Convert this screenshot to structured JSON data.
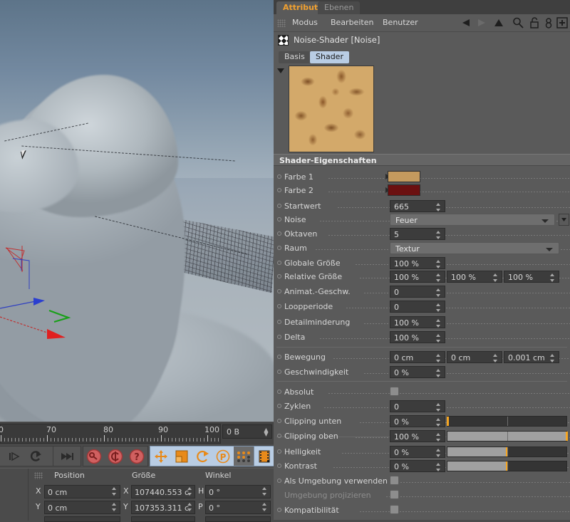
{
  "attribute_manager": {
    "tabs": [
      {
        "label": "Attribute",
        "active": true
      },
      {
        "label": "Ebenen",
        "active": false
      }
    ],
    "menu": [
      "Modus",
      "Bearbeiten",
      "Benutzer"
    ],
    "menu_icons": [
      "back-arrow-icon",
      "forward-arrow-icon",
      "up-arrow-icon",
      "search-icon",
      "unlock-icon",
      "link-icon",
      "plus-box-icon"
    ],
    "object_name": "Noise-Shader [Noise]",
    "subtabs": [
      {
        "label": "Basis",
        "active": false
      },
      {
        "label": "Shader",
        "active": true
      }
    ],
    "section_title": "Shader-Eigenschaften",
    "colors": {
      "accent_orange": "#f0a030",
      "tab_active_blue": "#b9cde4",
      "farbe1": "#c49a5e",
      "farbe2": "#6b1010",
      "slider_handle": "#f5a623"
    },
    "properties": [
      {
        "label": "Farbe 1",
        "type": "color",
        "value": "#c49a5e"
      },
      {
        "label": "Farbe 2",
        "type": "color",
        "value": "#6b1010"
      },
      {
        "label": "Startwert",
        "type": "number",
        "value": "665"
      },
      {
        "label": "Noise",
        "type": "combo",
        "value": "Feuer"
      },
      {
        "label": "Oktaven",
        "type": "number",
        "value": "5"
      },
      {
        "label": "Raum",
        "type": "combo",
        "value": "Textur"
      },
      {
        "label": "Globale Größe",
        "type": "number",
        "value": "100 %"
      },
      {
        "label": "Relative Größe",
        "type": "number3",
        "value": "100 %",
        "value2": "100 %",
        "value3": "100 %"
      },
      {
        "label": "Animat.-Geschw.",
        "type": "number",
        "value": "0"
      },
      {
        "label": "Loopperiode",
        "type": "number",
        "value": "0"
      },
      {
        "label": "Detailminderung",
        "type": "number",
        "value": "100 %"
      },
      {
        "label": "Delta",
        "type": "number",
        "value": "100 %"
      },
      {
        "label": "Bewegung",
        "type": "number3",
        "value": "0 cm",
        "value2": "0 cm",
        "value3": "0.001 cm"
      },
      {
        "label": "Geschwindigkeit",
        "type": "number",
        "value": "0 %"
      },
      {
        "label": "Absolut",
        "type": "checkbox",
        "checked": false
      },
      {
        "label": "Zyklen",
        "type": "number",
        "value": "0"
      },
      {
        "label": "Clipping unten",
        "type": "slider",
        "value": "0 %",
        "fill": 0
      },
      {
        "label": "Clipping oben",
        "type": "slider",
        "value": "100 %",
        "fill": 100
      },
      {
        "label": "Helligkeit",
        "type": "slider",
        "value": "0 %",
        "fill": 50
      },
      {
        "label": "Kontrast",
        "type": "slider",
        "value": "0 %",
        "fill": 50
      },
      {
        "label": "Als Umgebung verwenden",
        "type": "checkbox",
        "checked": false
      },
      {
        "label": "Umgebung projizieren",
        "type": "checkbox",
        "checked": false,
        "disabled": true
      },
      {
        "label": "Kompatibilität",
        "type": "checkbox",
        "checked": false
      }
    ]
  },
  "viewport": {
    "gizmo_axes": [
      "x-axis-red",
      "y-axis-green",
      "z-axis-blue"
    ],
    "cursor": "mouse-pointer"
  },
  "timeline": {
    "tick_labels": [
      "0",
      "70",
      "80",
      "90",
      "100"
    ],
    "frame_value": "0 B"
  },
  "toolbar": {
    "buttons": [
      "play-forward-icon",
      "play-step-icon",
      "loop-icon",
      "goto-end-icon",
      "record-key-icon",
      "autokey-icon",
      "keyframe-help-icon",
      "move-tool-icon",
      "scale-tool-icon",
      "rotate-tool-icon",
      "parametric-tool-icon",
      "points-tool-icon",
      "render-view-icon"
    ]
  },
  "coordinates": {
    "headers": [
      "Position",
      "Größe",
      "Winkel"
    ],
    "rows": [
      {
        "axis": "X",
        "position": "0 cm",
        "size": "107440.553 c",
        "angle_label": "H",
        "angle": "0 °"
      },
      {
        "axis": "Y",
        "position": "0 cm",
        "size": "107353.311 c",
        "angle_label": "P",
        "angle": "0 °"
      }
    ]
  }
}
